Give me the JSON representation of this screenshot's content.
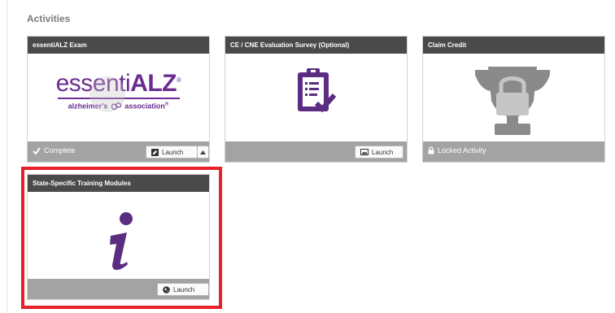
{
  "section": {
    "title": "Activities"
  },
  "cards": [
    {
      "title": "essentiALZ Exam",
      "logo": {
        "prefix": "essenti",
        "suffix": "ALZ",
        "registered": "®",
        "sub_left": "alzheimer's",
        "sub_right": "association",
        "sub_reg": "®"
      },
      "status": "Complete",
      "status_icon": "check-icon",
      "button_label": "Launch",
      "button_icon": "edit-square-icon",
      "has_dropdown": true
    },
    {
      "title": "CE / CNE Evaluation Survey (Optional)",
      "image_icon": "clipboard-checklist-icon",
      "button_label": "Launch",
      "button_icon": "image-icon"
    },
    {
      "title": "Claim Credit",
      "image_icon": "trophy-lock-icon",
      "status": "Locked Activity",
      "status_icon": "lock-icon"
    },
    {
      "title": "State-Specific Training Modules",
      "image_icon": "info-icon",
      "button_label": "Launch",
      "button_icon": "globe-icon",
      "highlighted": true
    }
  ],
  "colors": {
    "brand_purple": "#5b2d81",
    "header_bg": "#4a4a4a",
    "footer_bg": "#a3a3a3",
    "highlight": "#e8202a",
    "trophy_gray": "#8a8a8a"
  }
}
